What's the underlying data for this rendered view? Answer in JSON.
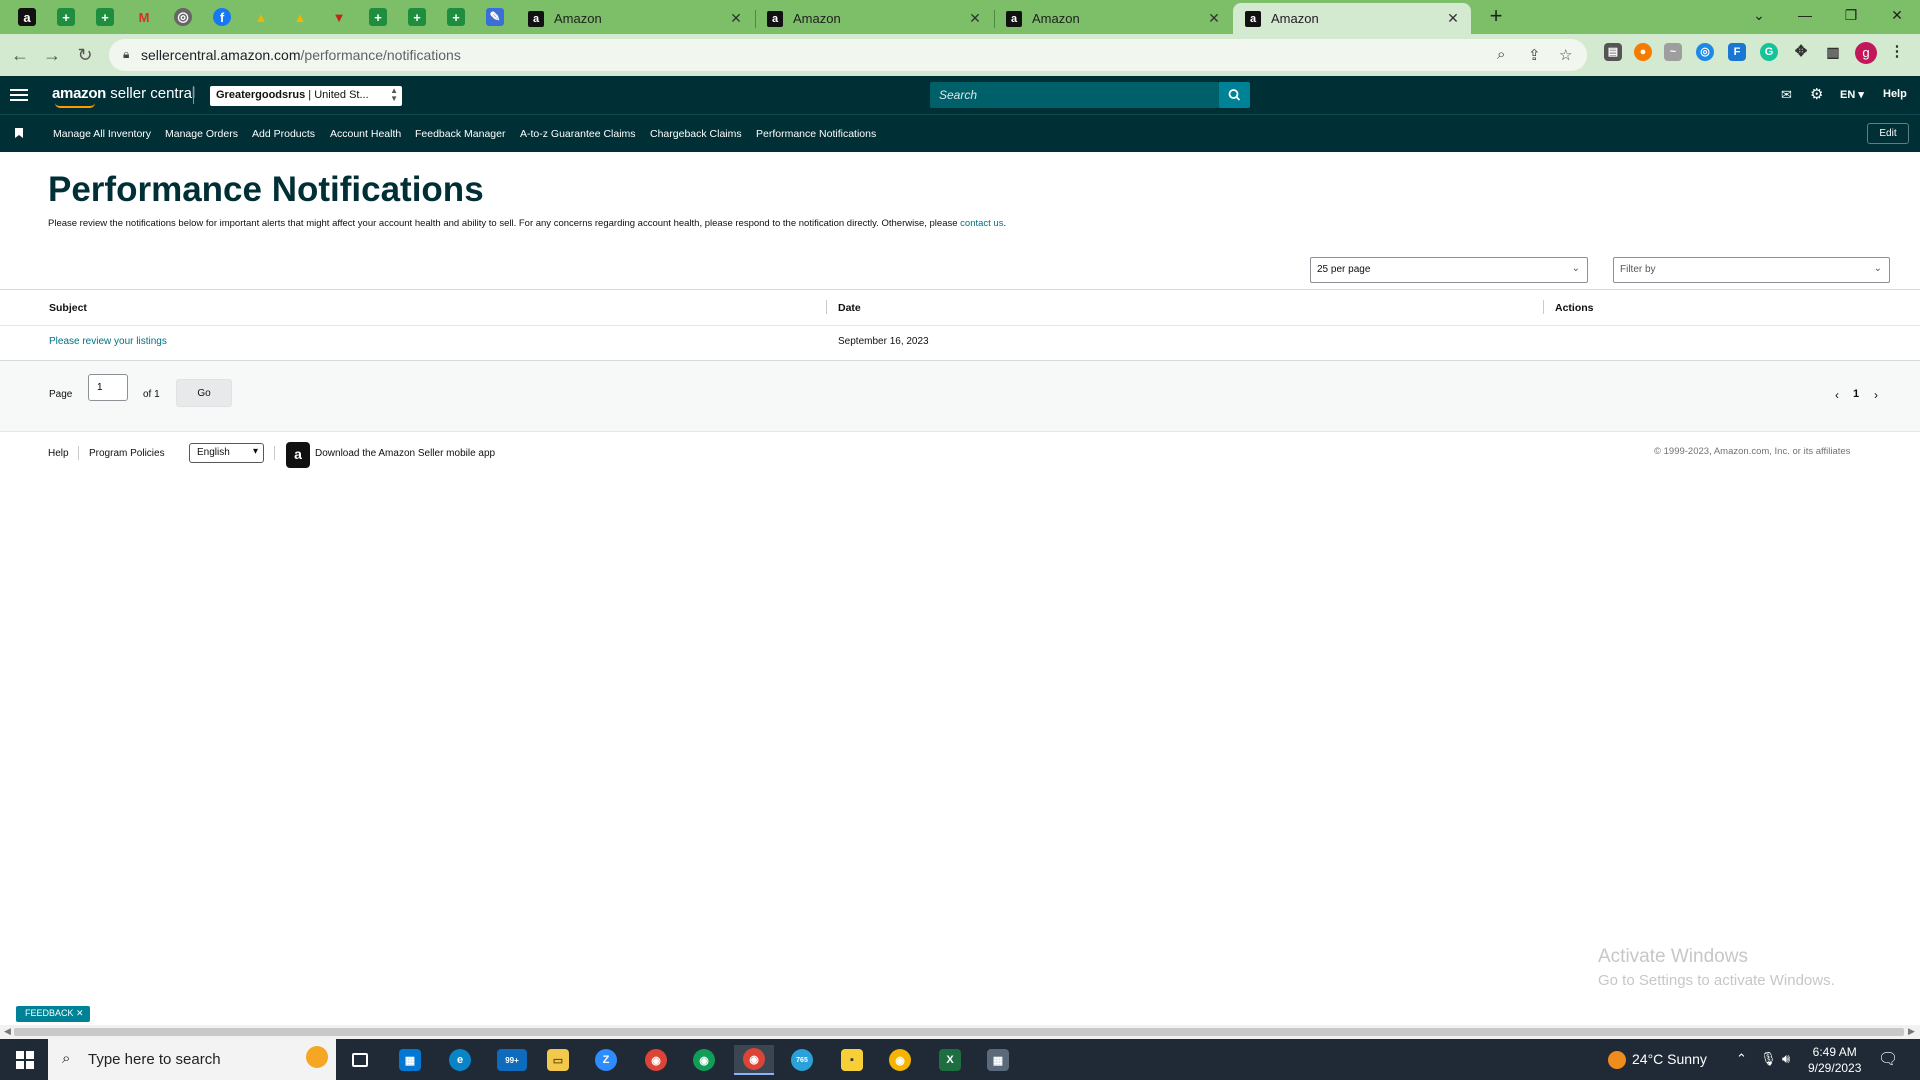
{
  "browser": {
    "tabs": [
      {
        "label": "Amazon"
      },
      {
        "label": "Amazon"
      },
      {
        "label": "Amazon"
      },
      {
        "label": "Amazon"
      }
    ],
    "url_host": "sellercentral.amazon.com",
    "url_path": "/performance/notifications",
    "profile_initial": "g",
    "accent": "#7dbf69"
  },
  "header": {
    "logo_main": "amazon",
    "logo_sub": " seller central",
    "account_name": "Greatergoodsrus",
    "account_region": " | United St...",
    "search_placeholder": "Search",
    "lang": "EN",
    "help": "Help",
    "bg_color": "#002f36"
  },
  "nav": {
    "items": [
      {
        "label": "Manage All Inventory"
      },
      {
        "label": "Manage Orders"
      },
      {
        "label": "Add Products"
      },
      {
        "label": "Account Health"
      },
      {
        "label": "Feedback Manager"
      },
      {
        "label": "A-to-z Guarantee Claims"
      },
      {
        "label": "Chargeback Claims"
      },
      {
        "label": "Performance Notifications"
      }
    ],
    "edit_label": "Edit"
  },
  "main": {
    "title": "Performance Notifications",
    "description": "Please review the notifications below for important alerts that might affect your account health and ability to sell. For any concerns regarding account health, please respond to the notification directly. Otherwise, please ",
    "contact_link": "contact us",
    "description_end": ".",
    "per_page": "25 per page",
    "filter_placeholder": "Filter by",
    "table": {
      "columns": [
        "Subject",
        "Date",
        "Actions"
      ],
      "rows": [
        {
          "subject": "Please review your listings",
          "date": "September 16, 2023",
          "actions": ""
        }
      ]
    },
    "pagination": {
      "page_label": "Page",
      "current_page": "1",
      "of_label": "of 1",
      "go_label": "Go",
      "page_number": "1"
    }
  },
  "footer": {
    "help": "Help",
    "program_policies": "Program Policies",
    "language": "English",
    "app_text": "Download the Amazon Seller mobile app",
    "copyright": "© 1999-2023, Amazon.com, Inc. or its affiliates"
  },
  "overlay": {
    "activate_title": "Activate Windows",
    "activate_sub": "Go to Settings to activate Windows.",
    "feedback_label": "FEEDBACK"
  },
  "taskbar": {
    "search_placeholder": "Type here to search",
    "mail_badge": "99+",
    "telegram_badge": "765",
    "weather": "24°C  Sunny",
    "time": "6:49 AM",
    "date": "9/29/2023"
  }
}
